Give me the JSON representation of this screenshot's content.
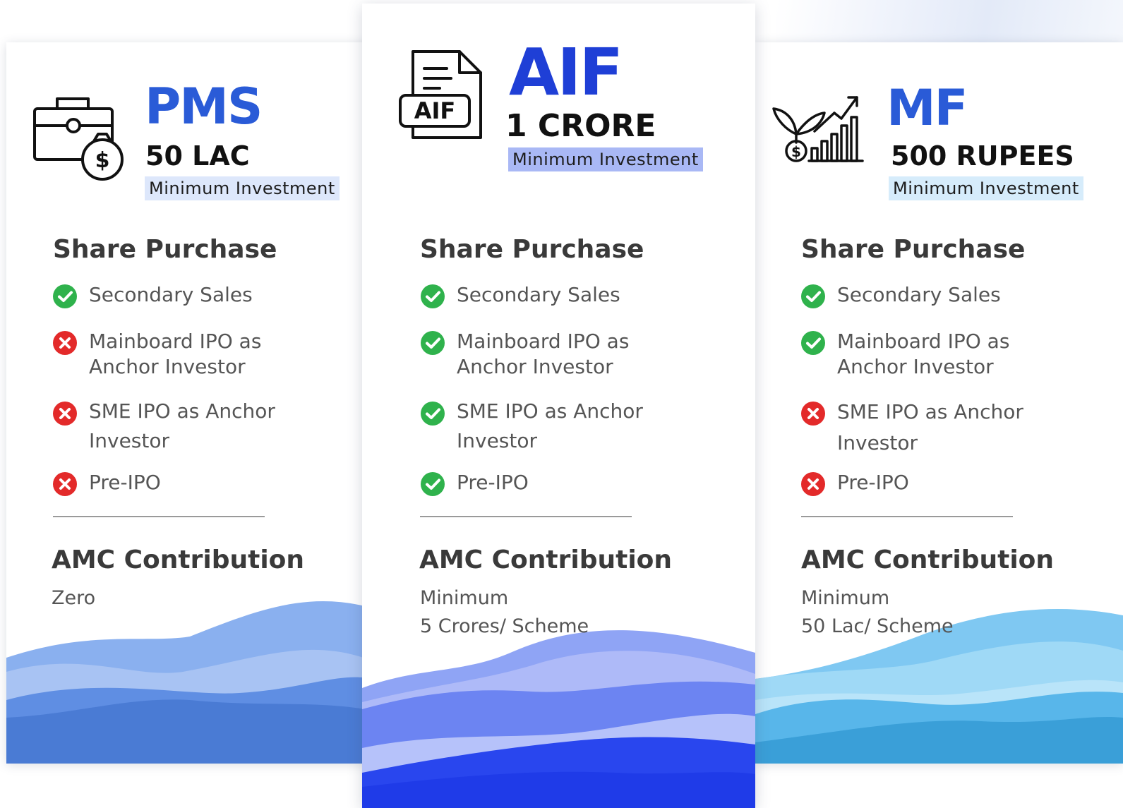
{
  "cards": {
    "pms": {
      "product": "PMS",
      "amount": "50 LAC",
      "badge": "Minimum  Investment",
      "icon": "briefcase-money-icon",
      "share_title": "Share Purchase",
      "features": [
        {
          "label": "Secondary Sales",
          "status": "check"
        },
        {
          "label": "Mainboard IPO as Anchor Investor",
          "status": "cross"
        },
        {
          "label": "SME IPO as Anchor Investor",
          "status": "cross"
        },
        {
          "label": "Pre-IPO",
          "status": "cross"
        }
      ],
      "amc_title": "AMC Contribution",
      "amc_line1": "Zero",
      "amc_line2": ""
    },
    "aif": {
      "product": "AIF",
      "amount": "1 CRORE",
      "badge": "Minimum  Investment",
      "icon": "aif-document-icon",
      "icon_text": "AIF",
      "share_title": "Share Purchase",
      "features": [
        {
          "label": "Secondary Sales",
          "status": "check"
        },
        {
          "label": "Mainboard IPO as Anchor Investor",
          "status": "check"
        },
        {
          "label": "SME IPO as Anchor Investor",
          "status": "check"
        },
        {
          "label": "Pre-IPO",
          "status": "check"
        }
      ],
      "amc_title": "AMC Contribution",
      "amc_line1": "Minimum",
      "amc_line2": "5 Crores/ Scheme"
    },
    "mf": {
      "product": "MF",
      "amount": "500 RUPEES",
      "badge": "Minimum  Investment",
      "icon": "plant-growth-chart-icon",
      "share_title": "Share Purchase",
      "features": [
        {
          "label": "Secondary Sales",
          "status": "check"
        },
        {
          "label": "Mainboard IPO as Anchor Investor",
          "status": "check"
        },
        {
          "label": "SME IPO as Anchor Investor",
          "status": "cross"
        },
        {
          "label": "Pre-IPO",
          "status": "cross"
        }
      ],
      "amc_title": "AMC Contribution",
      "amc_line1": "Minimum",
      "amc_line2": "50 Lac/ Scheme"
    }
  },
  "colors": {
    "product_blue": "#2a5bd7",
    "aif_blue": "#1f3fd6",
    "check_green": "#2fb24c",
    "cross_red": "#e32a2a",
    "badge_pms": "#dde7fb",
    "badge_aif": "#a9b8f5",
    "badge_mf": "#d6ecfb"
  }
}
